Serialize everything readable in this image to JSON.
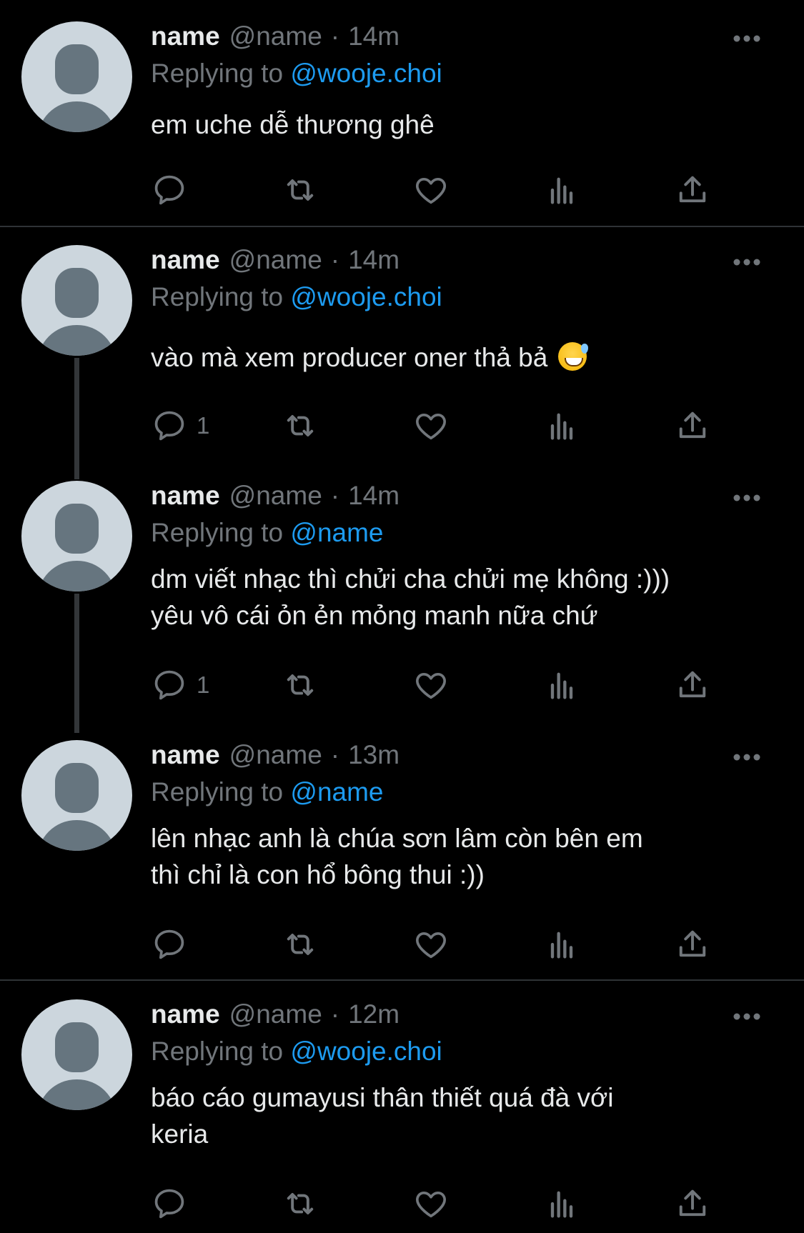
{
  "colors": {
    "background": "#000000",
    "text": "#e7e9ea",
    "muted": "#71767b",
    "accent": "#1d9bf0",
    "divider": "#2f3336"
  },
  "tweets": [
    {
      "name": "name",
      "handle": "@name",
      "sep": "·",
      "time": "14m",
      "replying_prefix": "Replying to",
      "replying_to": "@wooje.choi",
      "text": "em uche dễ thương ghê",
      "emoji": "",
      "reply_count": ""
    },
    {
      "name": "name",
      "handle": "@name",
      "sep": "·",
      "time": "14m",
      "replying_prefix": "Replying to",
      "replying_to": "@wooje.choi",
      "text": "vào mà xem producer oner thả bả ",
      "emoji": "grinning-sweat-emoji",
      "reply_count": "1"
    },
    {
      "name": "name",
      "handle": "@name",
      "sep": "·",
      "time": "14m",
      "replying_prefix": "Replying to",
      "replying_to": "@name",
      "text": "dm viết nhạc thì chửi cha chửi mẹ không :)))\nyêu vô cái ỏn ẻn mỏng manh nữa chứ",
      "emoji": "",
      "reply_count": "1"
    },
    {
      "name": "name",
      "handle": "@name",
      "sep": "·",
      "time": "13m",
      "replying_prefix": "Replying to",
      "replying_to": "@name",
      "text": "lên nhạc anh là chúa sơn lâm còn bên em\nthì chỉ là con hổ bông thui :))",
      "emoji": "",
      "reply_count": ""
    },
    {
      "name": "name",
      "handle": "@name",
      "sep": "·",
      "time": "12m",
      "replying_prefix": "Replying to",
      "replying_to": "@wooje.choi",
      "text": "báo cáo gumayusi thân thiết quá đà với\nkeria",
      "emoji": "",
      "reply_count": ""
    }
  ],
  "icons": {
    "reply": "reply-icon",
    "retweet": "retweet-icon",
    "like": "heart-icon",
    "views": "views-icon",
    "share": "share-icon",
    "more": "more-icon"
  }
}
